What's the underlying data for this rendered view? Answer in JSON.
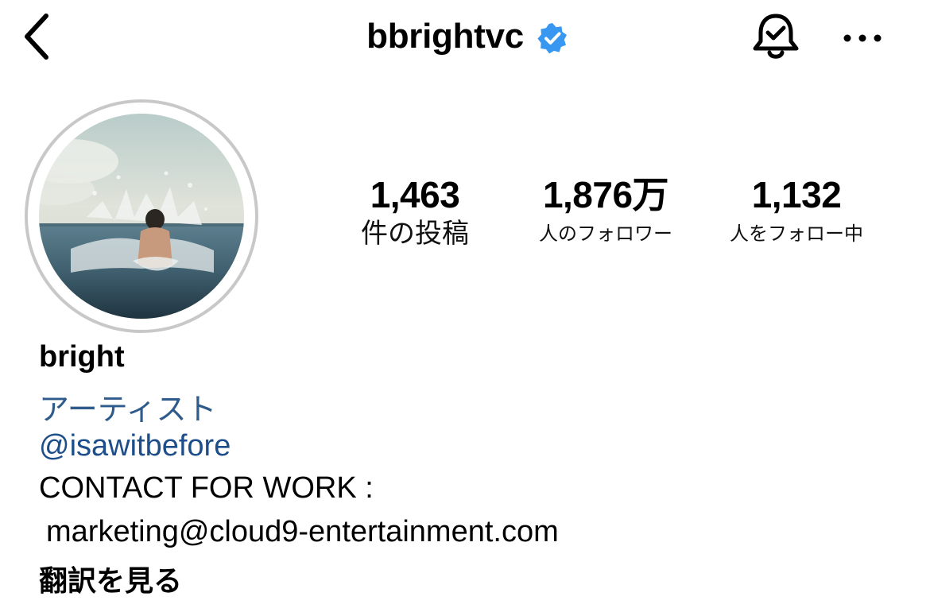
{
  "header": {
    "username": "bbrightvc",
    "back_icon": "chevron-left-icon",
    "verified_icon": "verified-badge-icon",
    "notification_icon": "bell-check-icon",
    "more_icon": "more-horizontal-icon"
  },
  "stats": {
    "posts": {
      "value": "1,463",
      "label": "件の投稿"
    },
    "followers": {
      "value": "1,876万",
      "label": "人のフォロワー"
    },
    "following": {
      "value": "1,132",
      "label": "人をフォロー中"
    }
  },
  "bio": {
    "display_name": "bright",
    "category": "アーティスト",
    "mention": "@isawitbefore",
    "line1": "CONTACT FOR WORK :",
    "line2": "marketing@cloud9-entertainment.com",
    "translate": "翻訳を見る"
  },
  "colors": {
    "verified": "#3897f0",
    "link": "#1d4e89",
    "category": "#2e5b8c",
    "avatar_ring": "#c8c8c8"
  }
}
